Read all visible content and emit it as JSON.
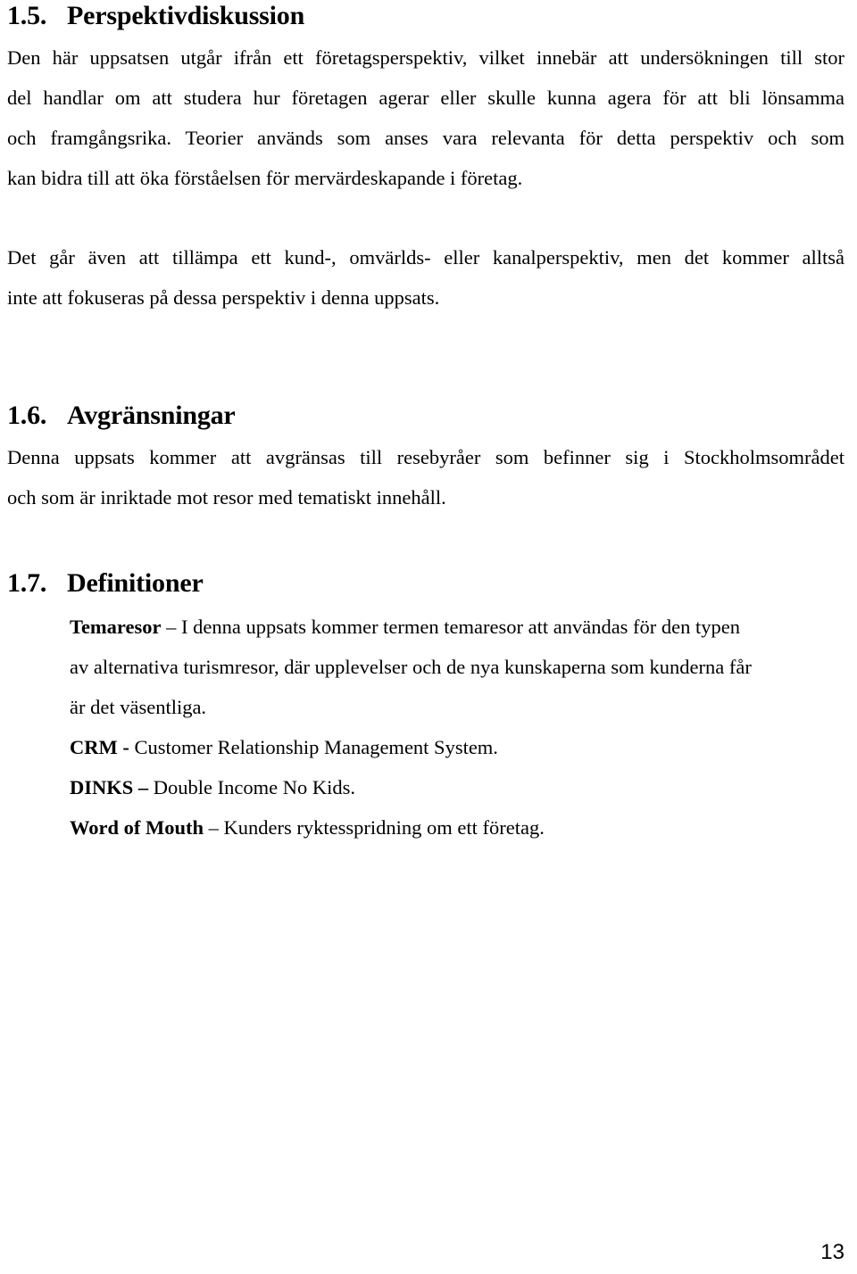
{
  "document": {
    "page_number": "13",
    "language": "sv"
  },
  "sections": [
    {
      "number": "1.5.",
      "title": "Perspektivdiskussion",
      "paragraphs": [
        {
          "lines": [
            "Den här uppsatsen utgår ifrån ett företagsperspektiv, vilket innebär att undersökningen till stor",
            "del handlar om att studera hur företagen agerar eller skulle kunna agera för att bli lönsamma",
            "och framgångsrika. Teorier används som anses vara relevanta för detta perspektiv och som",
            "kan bidra till att öka förståelsen för mervärdeskapande i företag."
          ]
        },
        {
          "lines": [
            "Det går även att tillämpa ett kund-, omvärlds- eller kanalperspektiv, men det kommer alltså",
            "inte att fokuseras på dessa perspektiv i denna uppsats."
          ]
        }
      ]
    },
    {
      "number": "1.6.",
      "title": "Avgränsningar",
      "paragraphs": [
        {
          "lines": [
            "Denna uppsats kommer att avgränsas till resebyråer som befinner sig i Stockholmsområdet",
            "och som är inriktade mot resor med tematiskt innehåll."
          ]
        }
      ]
    },
    {
      "number": "1.7.",
      "title": "Definitioner",
      "intro": {
        "term": "Temaresor",
        "dash": " – ",
        "lines": [
          "I denna uppsats kommer termen temaresor att användas för den typen",
          "av alternativa turismresor, där upplevelser och de nya kunskaperna som kunderna får",
          "är det väsentliga."
        ]
      },
      "definitions": [
        {
          "term": "CRM",
          "dash": " - ",
          "text": "Customer Relationship Management System."
        },
        {
          "term": "DINKS",
          "dash": " – ",
          "text": "Double Income No Kids."
        },
        {
          "term": "Word of Mouth",
          "dash": " – ",
          "text": "Kunders ryktesspridning om ett företag."
        }
      ]
    }
  ]
}
